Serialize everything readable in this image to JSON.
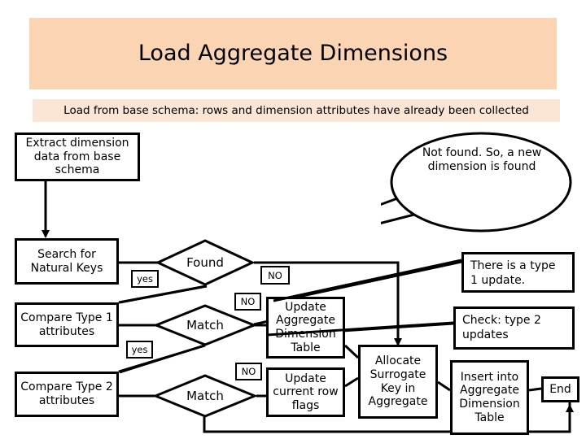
{
  "header": {
    "title": "Load Aggregate Dimensions",
    "band_color": "#fbd5b3"
  },
  "subtitle": {
    "text": "Load from base schema: rows and dimension attributes have already been collected",
    "band_color": "#fbe6d6"
  },
  "flow": {
    "nodes": {
      "extract": "Extract  dimension data from base schema",
      "search_keys": "Search for Natural Keys",
      "compare_type1": "Compare Type 1 attributes",
      "compare_type2": "Compare Type 2 attributes",
      "found_decision": "Found",
      "match_decision_1": "Match",
      "match_decision_2": "Match",
      "update_agg_dim_table": "Update Aggregate Dimension Table",
      "update_current_row_flags": "Update current row flags",
      "allocate_surrogate_key": "Allocate Surrogate Key in Aggregate",
      "insert_agg_dim_table": "Insert into Aggregate Dimension Table",
      "end": "End",
      "note_type1": "There is a type 1 update.",
      "note_type2": "Check:     type     2 updates"
    },
    "edge_labels": {
      "found_yes": "yes",
      "found_no": "NO",
      "match1_no": "NO",
      "match1_yes": "yes",
      "match2_no": "NO"
    },
    "callout": {
      "text": "Not found. So, a new dimension is found"
    }
  },
  "style": {
    "stroke": "#000000",
    "fill": "#ffffff"
  }
}
